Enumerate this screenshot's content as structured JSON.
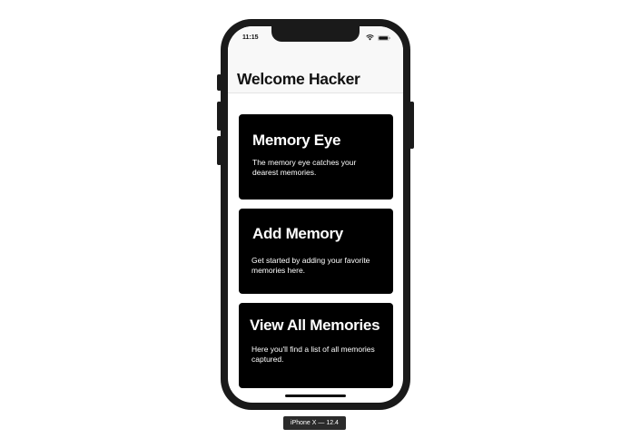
{
  "status_bar": {
    "time": "11:15",
    "wifi_icon": "wifi-icon",
    "battery_icon": "battery-icon"
  },
  "nav": {
    "title": "Welcome Hacker"
  },
  "cards": [
    {
      "title": "Memory Eye",
      "description": "The memory eye catches your dearest memories."
    },
    {
      "title": "Add Memory",
      "description": "Get started by adding your favorite memories here."
    },
    {
      "title": "View All Memories",
      "description": "Here you'll find a list of all memories captured."
    }
  ],
  "device_label": "iPhone X — 12.4"
}
